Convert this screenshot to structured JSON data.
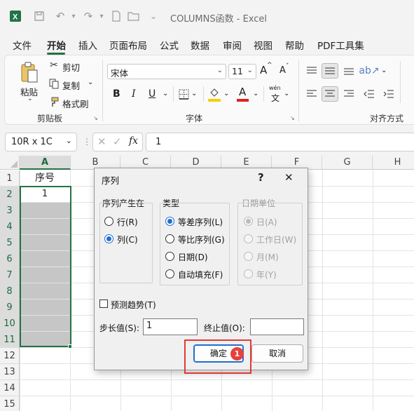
{
  "window": {
    "title": "COLUMNS函数 - Excel",
    "app_icon": "excel-logo-icon",
    "quick_access": [
      "save-icon",
      "undo-icon",
      "redo-icon",
      "new-file-icon",
      "open-folder-icon"
    ]
  },
  "menu": {
    "tabs": [
      "文件",
      "开始",
      "插入",
      "页面布局",
      "公式",
      "数据",
      "审阅",
      "视图",
      "帮助",
      "PDF工具集"
    ],
    "active": "开始"
  },
  "ribbon": {
    "clipboard": {
      "paste": "粘贴",
      "cut": "剪切",
      "copy": "复制",
      "format_painter": "格式刷",
      "label": "剪贴板"
    },
    "font": {
      "font_name": "宋体",
      "font_size": "11",
      "grow": "A",
      "shrink": "A",
      "bold": "B",
      "italic": "I",
      "underline": "U",
      "font_color_letter": "A",
      "phonetic": "wén",
      "label": "字体"
    },
    "alignment": {
      "label": "对齐方式"
    },
    "colors": {
      "highlight": "#f5d000",
      "font_color": "#e02020",
      "accent": "#217346"
    }
  },
  "formula_bar": {
    "name_box": "10R x 1C",
    "fx": "fx",
    "value": "1"
  },
  "sheet": {
    "columns": [
      "A",
      "B",
      "C",
      "D",
      "E",
      "F",
      "G",
      "H"
    ],
    "rows": [
      "1",
      "2",
      "3",
      "4",
      "5",
      "6",
      "7",
      "8",
      "9",
      "10",
      "11",
      "12",
      "13",
      "14",
      "15"
    ],
    "cells": {
      "A1": "序号",
      "A2": "1"
    }
  },
  "dialog": {
    "title": "序列",
    "help": "?",
    "close": "✕",
    "series_in": {
      "label": "序列产生在",
      "options": [
        "行(R)",
        "列(C)"
      ],
      "selected": "列(C)"
    },
    "type": {
      "label": "类型",
      "options": [
        "等差序列(L)",
        "等比序列(G)",
        "日期(D)",
        "自动填充(F)"
      ],
      "selected": "等差序列(L)"
    },
    "date_unit": {
      "label": "日期单位",
      "options": [
        "日(A)",
        "工作日(W)",
        "月(M)",
        "年(Y)"
      ],
      "selected": "日(A)",
      "disabled": true
    },
    "trend": {
      "label": "预测趋势(T)",
      "checked": false
    },
    "step": {
      "label": "步长值(S):",
      "value": "1"
    },
    "stop": {
      "label": "终止值(O):",
      "value": ""
    },
    "ok": "确定",
    "cancel": "取消",
    "step_badge": "1"
  }
}
